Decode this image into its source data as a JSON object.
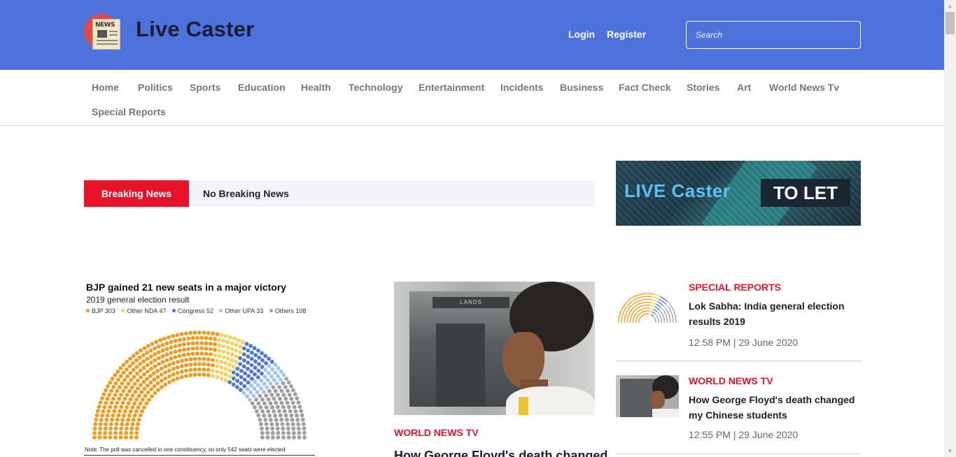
{
  "header": {
    "site_title": "Live Caster",
    "logo_text": "NEWS",
    "login_label": "Login",
    "register_label": "Register",
    "search_placeholder": "Search"
  },
  "nav": {
    "items": [
      "Home",
      "Politics",
      "Sports",
      "Education",
      "Health",
      "Technology",
      "Entertainment",
      "Incidents",
      "Business",
      "Fact Check",
      "Stories",
      "Art",
      "World News Tv",
      "Special Reports"
    ]
  },
  "breaking": {
    "label": "Breaking News",
    "text": "No Breaking News"
  },
  "ad": {
    "left_text": "LIVE Caster",
    "right_text": "TO LET"
  },
  "featured_chart": {
    "title": "BJP gained 21 new seats in a major victory",
    "subtitle": "2019 general election result",
    "note": "Note: The poll was cancelled in one constituency, so only 542 seats were elected",
    "legend": [
      {
        "label": "BJP 303",
        "color": "#f19a1b"
      },
      {
        "label": "Other NDA 47",
        "color": "#f7d15d"
      },
      {
        "label": "Congress 52",
        "color": "#4d79d6"
      },
      {
        "label": "Other UPA 33",
        "color": "#9dc4ec"
      },
      {
        "label": "Others 108",
        "color": "#9e9e9e"
      }
    ]
  },
  "chart_data": {
    "type": "parliament",
    "title": "BJP gained 21 new seats in a major victory",
    "subtitle": "2019 general election result",
    "categories": [
      "BJP",
      "Other NDA",
      "Congress",
      "Other UPA",
      "Others"
    ],
    "values": [
      303,
      47,
      52,
      33,
      108
    ],
    "colors": [
      "#f19a1b",
      "#f7d15d",
      "#4d79d6",
      "#9dc4ec",
      "#9e9e9e"
    ]
  },
  "center_article": {
    "category": "WORLD NEWS TV",
    "headline": "How George Floyd's death changed",
    "photo_sign": "LANDS"
  },
  "side_list": [
    {
      "category": "SPECIAL REPORTS",
      "headline": "Lok Sabha: India general election results 2019",
      "time": "12:58 PM | 29 June 2020"
    },
    {
      "category": "WORLD NEWS TV",
      "headline": "How George Floyd's death changed my Chinese students",
      "time": "12:55 PM | 29 June 2020"
    }
  ]
}
